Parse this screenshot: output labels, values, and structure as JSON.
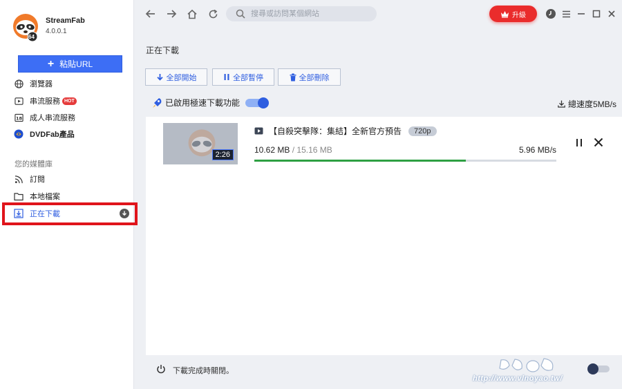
{
  "app": {
    "name": "StreamFab",
    "version": "4.0.0.1",
    "badge": "64"
  },
  "sidebar": {
    "paste_url_label": "粘貼URL",
    "items": [
      {
        "label": "瀏覽器",
        "icon": "globe-icon"
      },
      {
        "label": "串流服務",
        "icon": "play-icon",
        "badge": "HOT"
      },
      {
        "label": "成人串流服務",
        "icon": "adult-18-icon"
      },
      {
        "label": "DVDFab產品",
        "icon": "dvdfab-icon"
      }
    ],
    "library_label": "您的媒體庫",
    "library_items": [
      {
        "label": "訂閱",
        "icon": "rss-icon"
      },
      {
        "label": "本地檔案",
        "icon": "folder-icon"
      },
      {
        "label": "正在下載",
        "icon": "download-tray-icon",
        "active": true
      }
    ]
  },
  "topbar": {
    "search_placeholder": "搜尋或訪問某個網站",
    "upgrade_label": "升級"
  },
  "main": {
    "title": "正在下載",
    "toolbar": {
      "start_all": "全部開始",
      "pause_all": "全部暫停",
      "delete_all": "全部刪除"
    },
    "turbo_label": "已啟用極速下載功能",
    "total_speed": "總速度5MB/s",
    "download": {
      "duration": "2:26",
      "title": "【自殺突擊隊：集結】全新官方預告",
      "resolution": "720p",
      "downloaded": "10.62 MB",
      "separator": " / ",
      "total": "15.16 MB",
      "speed": "5.96 MB/s",
      "progress": 0.7
    },
    "footer_label": "下載完成時關閉。"
  },
  "watermark": {
    "text": "http://www.vlnoyao.tw/"
  },
  "colors": {
    "accent": "#2f5ee0",
    "upgrade": "#ea2c2c",
    "progress": "#2ea043",
    "highlight_box": "#e0141b"
  }
}
